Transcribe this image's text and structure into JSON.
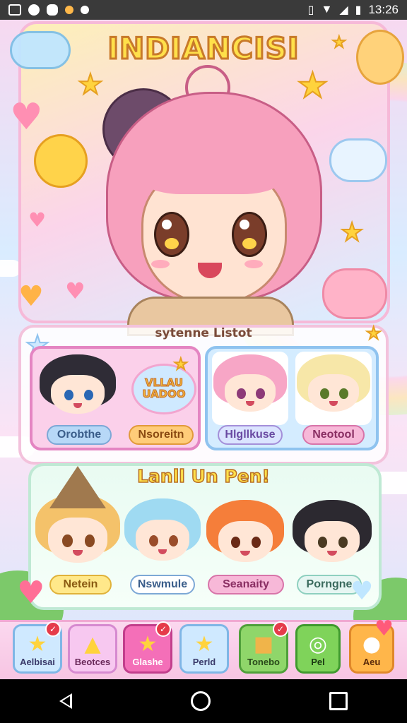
{
  "status_bar": {
    "time": "13:26",
    "icons": [
      "image-icon",
      "circle-status-icon",
      "shield-status-icon",
      "dot-icon",
      "vibrate-icon",
      "wifi-icon",
      "signal-icon",
      "battery-icon"
    ]
  },
  "hero": {
    "title": "INDIANCISI"
  },
  "panel_top": {
    "title": "sytenne Listot",
    "left_card": {
      "badge_text": "VLLAU\nUADOO",
      "labels": [
        "Orobthe",
        "Nsoreitn"
      ]
    },
    "right_card": {
      "labels": [
        "Hlgllkuse",
        "Neotool"
      ]
    }
  },
  "panel_bottom": {
    "title": "Lanll Un Pen!",
    "characters": [
      {
        "label": "Netein"
      },
      {
        "label": "Nswmule"
      },
      {
        "label": "Seanaity"
      },
      {
        "label": "Porngne"
      }
    ]
  },
  "bottom_tabs": [
    {
      "label": "Aelbisai",
      "icon": "star-icon",
      "badge": "✓"
    },
    {
      "label": "Beotces",
      "icon": "cat-icon"
    },
    {
      "label": "Glashe",
      "icon": "star-icon",
      "badge": "✓"
    },
    {
      "label": "Perld",
      "icon": "star-icon"
    },
    {
      "label": "Tonebo",
      "icon": "box-icon",
      "badge": "✓"
    },
    {
      "label": "Pel",
      "icon": "ring-icon"
    },
    {
      "label": "Aeu",
      "icon": "ghost-icon"
    }
  ],
  "colors": {
    "title_fill": "#ffe04a",
    "title_stroke": "#c87a2a",
    "hair_main": "#f7a0bd",
    "accent_pink": "#e485c2",
    "accent_blue": "#8fc3ef"
  }
}
